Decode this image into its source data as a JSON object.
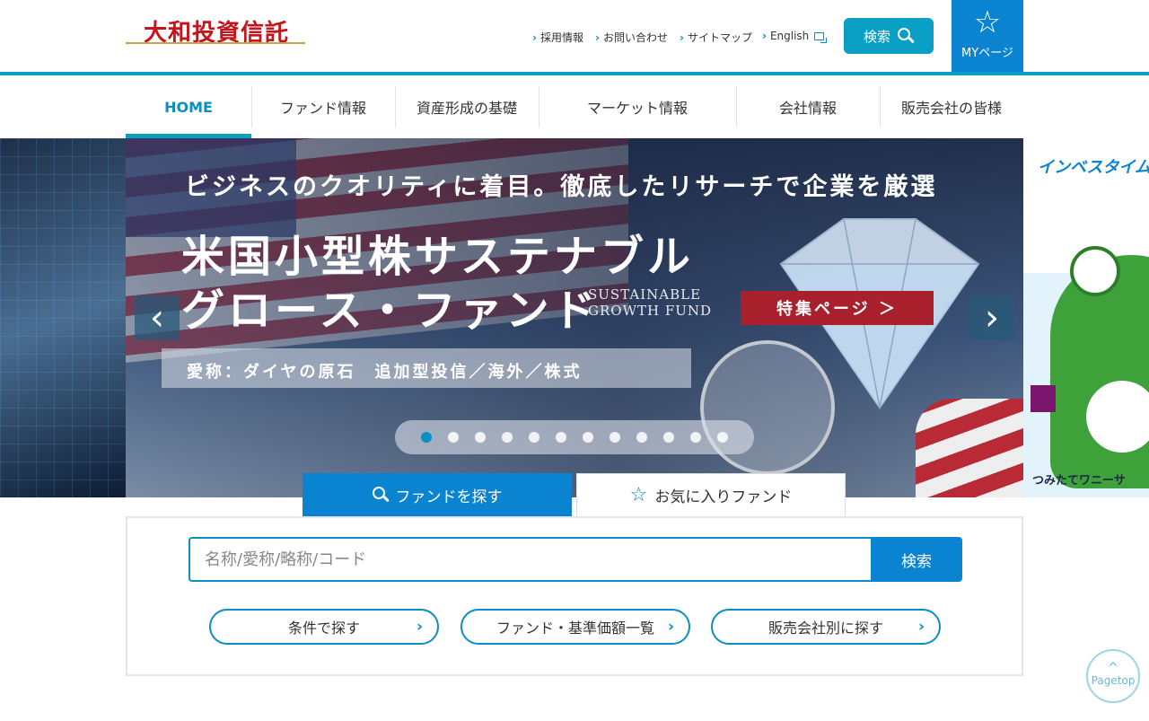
{
  "header": {
    "logo_text": "大和投資信託",
    "util_links": [
      "採用情報",
      "お問い合わせ",
      "サイトマップ",
      "English"
    ],
    "search_label": "検索",
    "mypage_label": "MYページ"
  },
  "nav": {
    "items": [
      {
        "label": "HOME",
        "active": true
      },
      {
        "label": "ファンド情報"
      },
      {
        "label": "資産形成の基礎"
      },
      {
        "label": "マーケット情報"
      },
      {
        "label": "会社情報"
      },
      {
        "label": "販売会社の皆様"
      }
    ]
  },
  "carousel": {
    "catch": "ビジネスのクオリティに着目。徹底したリサーチで企業を厳選",
    "title_line1": "米国小型株サステナブル",
    "title_line2": "グロース・ファンド",
    "title_en_line1": "SUSTAINABLE",
    "title_en_line2": "GROWTH FUND",
    "cta": "特集ページ ＞",
    "sub": "愛称：ダイヤの原石　追加型投信／海外／株式",
    "right_brand": "インベスタイム",
    "right_caption": "つみたてワニーサ",
    "dot_count": 12,
    "active_dot": 0,
    "prev_arrow": "‹",
    "next_arrow": "›"
  },
  "search": {
    "tab_search_label": "ファンドを探す",
    "tab_fav_label": "お気に入りファンド",
    "placeholder": "名称/愛称/略称/コード",
    "submit_label": "検索",
    "buttons": [
      "条件で探す",
      "ファンド・基準価額一覧",
      "販売会社別に探す"
    ]
  },
  "pagetop": {
    "label": "Pagetop"
  },
  "colors": {
    "accent": "#0aa0c5",
    "brand_blue": "#0a83d0",
    "logo_red": "#c4151c"
  }
}
